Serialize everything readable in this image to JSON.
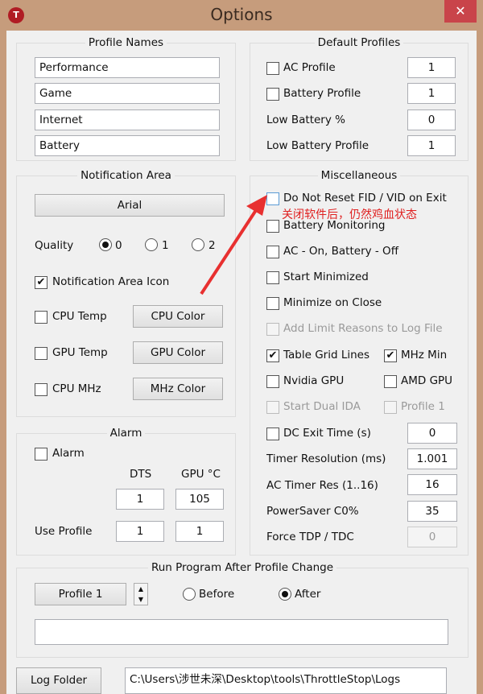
{
  "window": {
    "title": "Options",
    "close": "✕",
    "app_icon": "T"
  },
  "profile_names": {
    "title": "Profile Names",
    "names": [
      "Performance",
      "Game",
      "Internet",
      "Battery"
    ]
  },
  "default_profiles": {
    "title": "Default Profiles",
    "ac_profile": {
      "label": "AC Profile",
      "checked": false,
      "value": "1"
    },
    "battery_profile": {
      "label": "Battery Profile",
      "checked": false,
      "value": "1"
    },
    "low_battery_pct": {
      "label": "Low Battery %",
      "value": "0"
    },
    "low_battery_profile": {
      "label": "Low Battery Profile",
      "value": "1"
    }
  },
  "notification": {
    "title": "Notification Area",
    "font_button": "Arial",
    "quality_label": "Quality",
    "quality_options": [
      "0",
      "1",
      "2"
    ],
    "quality_selected": "0",
    "icon": {
      "label": "Notification Area Icon",
      "checked": true
    },
    "cpu_temp": {
      "label": "CPU Temp",
      "button": "CPU Color",
      "checked": false
    },
    "gpu_temp": {
      "label": "GPU Temp",
      "button": "GPU Color",
      "checked": false
    },
    "cpu_mhz": {
      "label": "CPU MHz",
      "button": "MHz Color",
      "checked": false
    }
  },
  "alarm": {
    "title": "Alarm",
    "alarm_label": "Alarm",
    "checked": false,
    "col_dts": "DTS",
    "col_gpu": "GPU °C",
    "dts": "1",
    "gpu": "105",
    "use_profile": "Use Profile",
    "use_dts": "1",
    "use_gpu": "1"
  },
  "misc": {
    "title": "Miscellaneous",
    "annotation": "关闭软件后，仍然鸡血状态",
    "annotation_color": "#e02020",
    "do_not_reset": "Do Not Reset FID / VID on Exit",
    "battery_monitoring": "Battery Monitoring",
    "ac_on": "AC - On, Battery - Off",
    "start_minimized": "Start Minimized",
    "minimize_close": "Minimize on Close",
    "add_limit": "Add Limit Reasons to Log File",
    "table_grid": "Table Grid Lines",
    "mhz_min": "MHz Min",
    "nvidia": "Nvidia GPU",
    "amd": "AMD GPU",
    "dual_ida": "Start Dual IDA",
    "profile1": "Profile 1",
    "dc_exit": "DC Exit Time (s)",
    "dc_exit_val": "0",
    "timer_res": "Timer Resolution (ms)",
    "timer_res_val": "1.001",
    "ac_timer": "AC Timer Res (1..16)",
    "ac_timer_val": "16",
    "powersaver": "PowerSaver C0%",
    "powersaver_val": "35",
    "force_tdp": "Force TDP / TDC",
    "force_tdp_val": "0"
  },
  "run_program": {
    "title": "Run Program After Profile Change",
    "profile_button": "Profile 1",
    "before": "Before",
    "after": "After",
    "selected": "After",
    "command": ""
  },
  "log": {
    "button": "Log Folder",
    "path": "C:\\Users\\涉世未深\\Desktop\\tools\\ThrottleStop\\Logs"
  }
}
